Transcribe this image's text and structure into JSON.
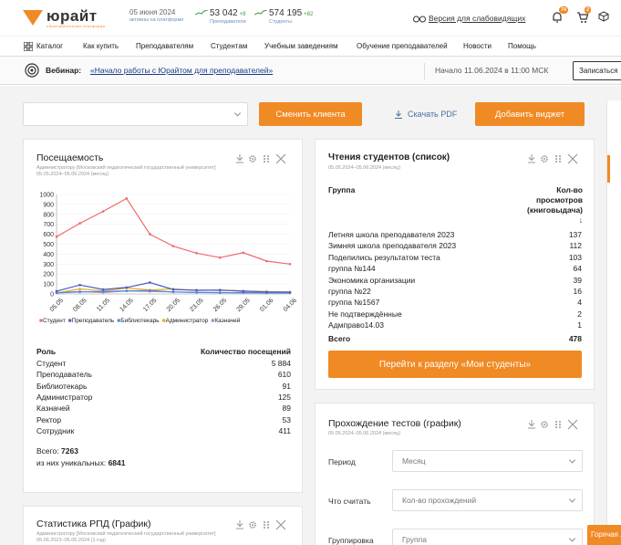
{
  "header": {
    "logo_text": "юрайт",
    "logo_sub": "образовательная платформа",
    "date": "05 июня 2024",
    "date_sub": "активны на платформе",
    "stat1_value": "53 042",
    "stat1_delta": "+8",
    "stat1_label": "Преподаватели",
    "stat2_value": "574 195",
    "stat2_delta": "+82",
    "stat2_label": "Студенты",
    "vision_label": "Версия для слабовидящих",
    "notif_badge": "74",
    "cart_badge": "2"
  },
  "nav": {
    "items": [
      "Каталог",
      "Как купить",
      "Преподавателям",
      "Студентам",
      "Учебным заведениям",
      "Обучение преподавателей",
      "Новости",
      "Помощь"
    ]
  },
  "webinar": {
    "label": "Вебинар:",
    "link": "«Начало работы с Юрайтом для преподавателей»",
    "start": "Начало 11.06.2024 в 11:00 МСК",
    "register": "Записаться"
  },
  "toolbar": {
    "change_client": "Сменить клиента",
    "download_pdf": "Скачать PDF",
    "add_widget": "Добавить виджет"
  },
  "attendance": {
    "title": "Посещаемость",
    "sub1": "Администратору [Московский педагогический государственный университет]",
    "sub2": "05.05.2024–05.06.2024 (месяц)",
    "col_role": "Роль",
    "col_visits": "Количество посещений",
    "rows": [
      {
        "role": "Студент",
        "value": "5 884"
      },
      {
        "role": "Преподаватель",
        "value": "610"
      },
      {
        "role": "Библиотекарь",
        "value": "91"
      },
      {
        "role": "Администратор",
        "value": "125"
      },
      {
        "role": "Казначей",
        "value": "89"
      },
      {
        "role": "Ректор",
        "value": "53"
      },
      {
        "role": "Сотрудник",
        "value": "411"
      }
    ],
    "total_label": "Всего:",
    "total_value": "7263",
    "unique_label": "из них уникальных:",
    "unique_value": "6841"
  },
  "chart_data": {
    "type": "line",
    "x": [
      "05.05",
      "08.05",
      "11.05",
      "14.05",
      "17.05",
      "20.05",
      "23.05",
      "26.05",
      "29.05",
      "01.06",
      "04.06"
    ],
    "yticks": [
      0,
      100,
      200,
      300,
      400,
      500,
      600,
      700,
      800,
      900,
      1000
    ],
    "ylim": [
      0,
      1000
    ],
    "series": [
      {
        "name": "Студент",
        "color": "#f06a6a",
        "values": [
          575,
          710,
          830,
          960,
          600,
          480,
          410,
          365,
          415,
          330,
          300
        ]
      },
      {
        "name": "Преподаватель",
        "color": "#4a5ac9",
        "values": [
          28,
          90,
          45,
          65,
          115,
          45,
          38,
          38,
          28,
          20,
          18
        ]
      },
      {
        "name": "Библиотекарь",
        "color": "#4a8ad9",
        "values": [
          10,
          20,
          25,
          30,
          35,
          20,
          15,
          12,
          15,
          10,
          10
        ]
      },
      {
        "name": "Администратор",
        "color": "#e0b020",
        "values": [
          10,
          50,
          30,
          60,
          40,
          50,
          35,
          40,
          30,
          25,
          20
        ]
      },
      {
        "name": "Казначей",
        "color": "#b080d0",
        "values": [
          15,
          25,
          15,
          30,
          25,
          20,
          15,
          15,
          10,
          10,
          10
        ]
      }
    ]
  },
  "students": {
    "title": "Чтения студентов (список)",
    "sub": "05.05.2024–05.06.2024 (месяц)",
    "col_group": "Группа",
    "col_views_1": "Кол-во",
    "col_views_2": "просмотров",
    "col_views_3": "(книговыдача)",
    "sort_arrow": "↓",
    "rows": [
      {
        "group": "Летняя школа преподавателя 2023",
        "value": "137"
      },
      {
        "group": "Зимняя школа преподавателя 2023",
        "value": "112"
      },
      {
        "group": "Поделились результатом теста",
        "value": "103"
      },
      {
        "group": "группа №144",
        "value": "64"
      },
      {
        "group": "Экономика организации",
        "value": "39"
      },
      {
        "group": "группа №22",
        "value": "16"
      },
      {
        "group": "группа №1567",
        "value": "4"
      },
      {
        "group": "Не подтверждённые",
        "value": "2"
      },
      {
        "group": "Адмправо14.03",
        "value": "1"
      }
    ],
    "total_label": "Всего",
    "total_value": "478",
    "goto_button": "Перейти к разделу «Мои студенты»"
  },
  "tests": {
    "title": "Прохождение тестов (график)",
    "sub": "05.05.2024–05.06.2024 (месяц)",
    "period_label": "Период",
    "period_value": "Месяц",
    "count_label": "Что считать",
    "count_value": "Кол-во прохождений",
    "group_label": "Группировка",
    "group_value": "Группа"
  },
  "rpd": {
    "title": "Статистика РПД (График)",
    "sub1": "Администратору [Московский педагогический государственный университет]",
    "sub2": "05.06.2023–05.06.2024 (1 год)"
  },
  "hotline": "Горячая линия"
}
